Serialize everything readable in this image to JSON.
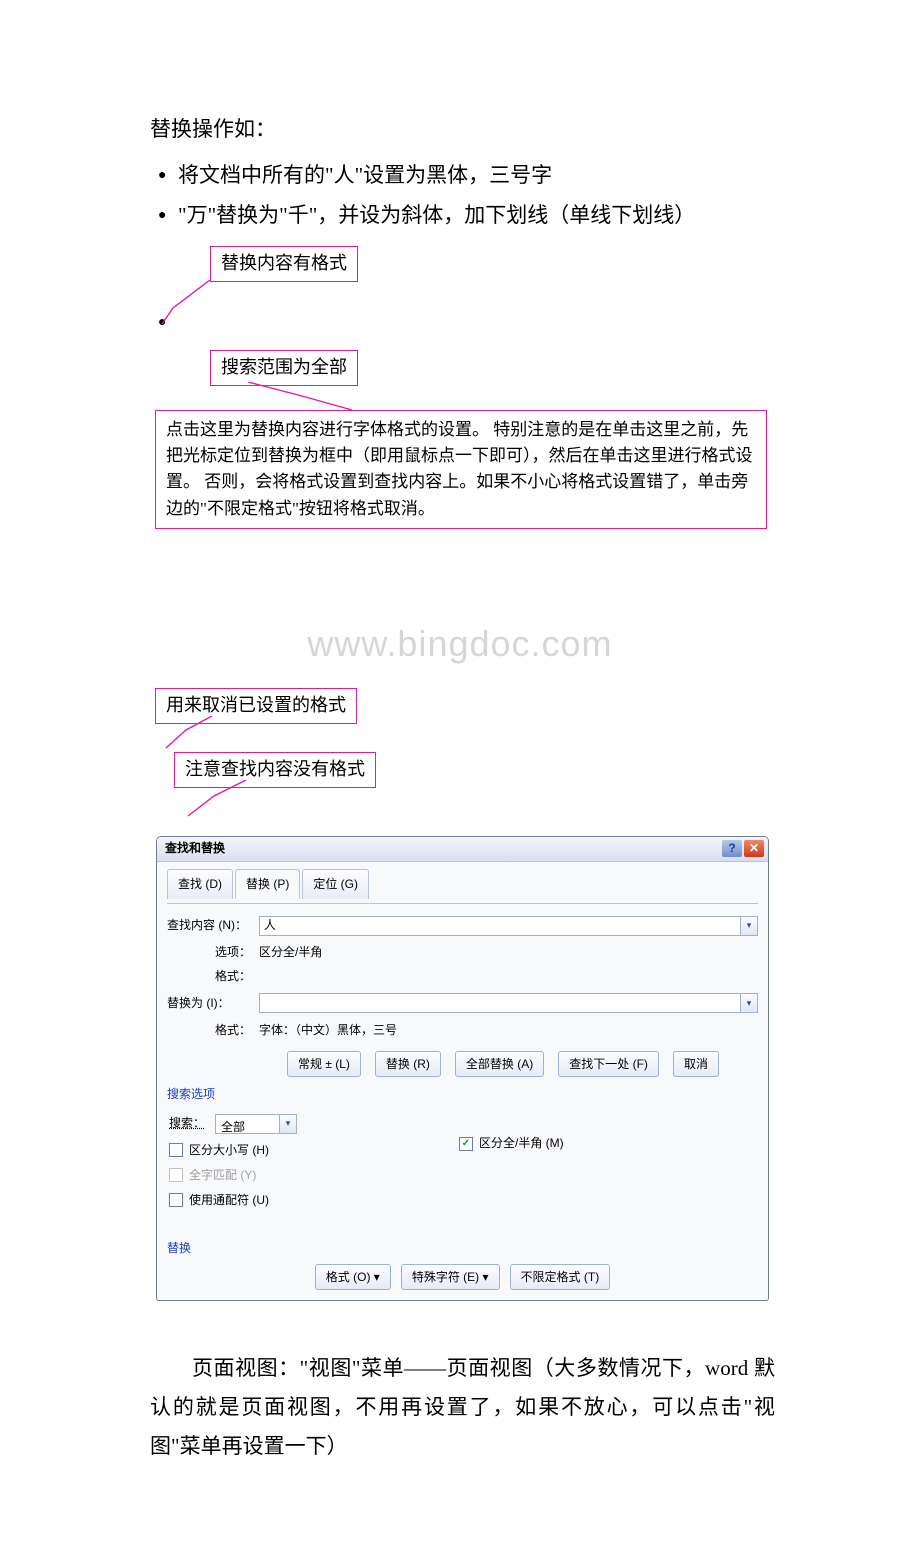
{
  "doc": {
    "heading": "替换操作如：",
    "bullets": [
      "将文档中所有的\"人\"设置为黑体，三号字",
      "\"万\"替换为\"千\"，并设为斜体，加下划线（单线下划线）"
    ]
  },
  "callouts": {
    "c1": "替换内容有格式",
    "c2": "搜索范围为全部",
    "c3": "点击这里为替换内容进行字体格式的设置。\n特别注意的是在单击这里之前，先把光标定位到替换为框中（即用鼠标点一下即可），然后在单击这里进行格式设置。\n否则，会将格式设置到查找内容上。如果不小心将格式设置错了，单击旁边的\"不限定格式\"按钮将格式取消。",
    "c4": "用来取消已设置的格式",
    "c5": "注意查找内容没有格式"
  },
  "watermark": "www.bingdoc.com",
  "dialog": {
    "title": "查找和替换",
    "tabs": {
      "find": "查找 (D)",
      "replace": "替换 (P)",
      "goto": "定位 (G)"
    },
    "find_label": "查找内容 (N)：",
    "find_value": "人",
    "options_label": "选项：",
    "options_value": "区分全/半角",
    "format_label": "格式：",
    "format_value_find": "",
    "replace_label": "替换为 (I)：",
    "replace_value": "",
    "format_value_replace": "字体：（中文）黑体，三号",
    "buttons": {
      "normal": "常规 ± (L)",
      "replace": "替换 (R)",
      "replace_all": "全部替换 (A)",
      "find_next": "查找下一处 (F)",
      "cancel": "取消"
    },
    "search_options_hdr": "搜索选项",
    "search_label": "搜索：",
    "search_value": "全部",
    "checks": {
      "case": "区分大小写 (H)",
      "whole": "全字匹配 (Y)",
      "wildcard": "使用通配符 (U)",
      "fullhalf": "区分全/半角 (M)"
    },
    "bottom_hdr": "替换",
    "bottom_buttons": {
      "format": "格式 (O) ▾",
      "special": "特殊字符 (E) ▾",
      "nofmt": "不限定格式 (T)"
    }
  },
  "trailing": "页面视图：\"视图\"菜单——页面视图（大多数情况下，word 默认的就是页面视图，不用再设置了，如果不放心，可以点击\"视图\"菜单再设置一下）"
}
